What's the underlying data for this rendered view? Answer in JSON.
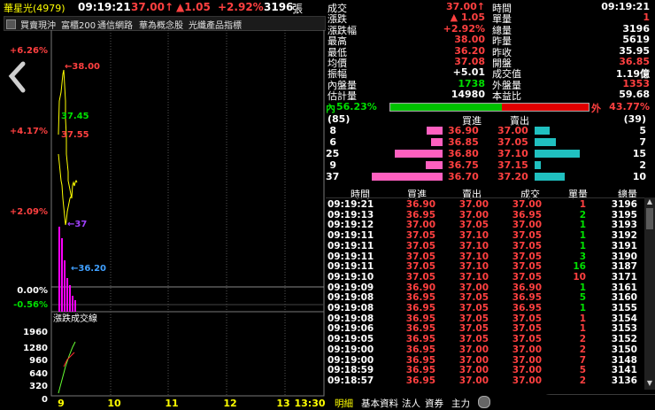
{
  "title": {
    "symbol": "華星光(4979)",
    "time": "09:19:21",
    "price": "37.00↑",
    "change": "▲1.05",
    "pct": "+2.92%",
    "volume": "3196",
    "unit": "張"
  },
  "tags": [
    "買賣現沖",
    "富櫃200",
    "通信網路",
    "華為概念股",
    "光纖產品指標"
  ],
  "chart": {
    "y_labels": [
      "+6.26%",
      "+4.17%",
      "+2.09%",
      "0.00%",
      "-0.56%"
    ],
    "x_labels": [
      "9",
      "10",
      "11",
      "12",
      "13",
      "13:30"
    ],
    "annotations": [
      "←38.00",
      "37.45",
      "37.55",
      "←37",
      "←36.20"
    ],
    "sub_title": "漲跌成交線",
    "vol_labels": [
      "1960",
      "1280",
      "960",
      "640",
      "320",
      "0"
    ],
    "nav_left_icon": "chevron-left",
    "colors": {
      "price_line": "#ffff00",
      "volume_bar": "#ff00ff",
      "vol_line_up": "#66ff33",
      "vol_line_dn": "#ff3030"
    }
  },
  "quote": {
    "left": [
      {
        "label": "成交",
        "value": "37.00↑",
        "color": "red"
      },
      {
        "label": "漲跌",
        "value": "▲  1.05",
        "color": "red"
      },
      {
        "label": "漲跌幅",
        "value": "+2.92%",
        "color": "red"
      },
      {
        "label": "最高",
        "value": "38.00",
        "color": "red"
      },
      {
        "label": "最低",
        "value": "36.20",
        "color": "red"
      },
      {
        "label": "均價",
        "value": "37.08",
        "color": "red"
      },
      {
        "label": "振幅",
        "value": "+5.01",
        "color": "wht"
      },
      {
        "label": "內盤量",
        "value": "1738",
        "color": "grn"
      },
      {
        "label": "估計量",
        "value": "14980",
        "color": "wht"
      }
    ],
    "right": [
      {
        "label": "時間",
        "value": "09:19:21",
        "color": "wht"
      },
      {
        "label": "單量",
        "value": "1",
        "color": "red"
      },
      {
        "label": "總量",
        "value": "3196",
        "color": "wht"
      },
      {
        "label": "昨量",
        "value": "5619",
        "color": "wht"
      },
      {
        "label": "昨收",
        "value": "35.95",
        "color": "wht"
      },
      {
        "label": "開盤",
        "value": "36.85",
        "color": "red"
      },
      {
        "label": "成交值",
        "value": "1.19億",
        "color": "wht"
      },
      {
        "label": "外盤量",
        "value": "1353",
        "color": "red"
      },
      {
        "label": "本益比",
        "value": "59.68",
        "color": "wht"
      }
    ]
  },
  "ratio": {
    "inner_label": "內",
    "inner_pct": "56.23%",
    "outer_label": "外",
    "outer_pct": "43.77%",
    "inner_fraction": 0.5623
  },
  "depth": {
    "bid_total": "(85)",
    "ask_total": "(39)",
    "bid_header": "買進",
    "ask_header": "賣出",
    "rows": [
      {
        "bid_qty": "8",
        "bid": "36.90",
        "ask": "37.00",
        "ask_qty": "5",
        "bid_frac": 0.22,
        "ask_frac": 0.5
      },
      {
        "bid_qty": "6",
        "bid": "36.85",
        "ask": "37.05",
        "ask_qty": "7",
        "bid_frac": 0.16,
        "ask_frac": 0.7
      },
      {
        "bid_qty": "25",
        "bid": "36.80",
        "ask": "37.10",
        "ask_qty": "15",
        "bid_frac": 0.68,
        "ask_frac": 1.5
      },
      {
        "bid_qty": "9",
        "bid": "36.75",
        "ask": "37.15",
        "ask_qty": "2",
        "bid_frac": 0.24,
        "ask_frac": 0.2
      },
      {
        "bid_qty": "37",
        "bid": "36.70",
        "ask": "37.20",
        "ask_qty": "10",
        "bid_frac": 1.0,
        "ask_frac": 1.0
      }
    ]
  },
  "ticks": {
    "headers": [
      "時間",
      "買進",
      "賣出",
      "成交",
      "單量",
      "總量"
    ],
    "rows": [
      [
        "09:19:21",
        "36.90",
        "37.00",
        "37.00",
        "1",
        "3196"
      ],
      [
        "09:19:13",
        "36.95",
        "37.00",
        "36.95",
        "2",
        "3195"
      ],
      [
        "09:19:12",
        "37.00",
        "37.05",
        "37.00",
        "1",
        "3193"
      ],
      [
        "09:19:11",
        "37.05",
        "37.10",
        "37.05",
        "1",
        "3192"
      ],
      [
        "09:19:11",
        "37.05",
        "37.10",
        "37.05",
        "1",
        "3191"
      ],
      [
        "09:19:11",
        "37.05",
        "37.10",
        "37.05",
        "3",
        "3190"
      ],
      [
        "09:19:11",
        "37.05",
        "37.10",
        "37.05",
        "16",
        "3187"
      ],
      [
        "09:19:10",
        "37.05",
        "37.10",
        "37.05",
        "10",
        "3171"
      ],
      [
        "09:19:09",
        "36.90",
        "37.00",
        "36.90",
        "1",
        "3161"
      ],
      [
        "09:19:08",
        "36.95",
        "37.05",
        "36.95",
        "5",
        "3160"
      ],
      [
        "09:19:08",
        "36.95",
        "37.05",
        "36.95",
        "1",
        "3155"
      ],
      [
        "09:19:08",
        "36.95",
        "37.05",
        "37.05",
        "1",
        "3154"
      ],
      [
        "09:19:06",
        "36.95",
        "37.05",
        "37.05",
        "1",
        "3153"
      ],
      [
        "09:19:05",
        "36.95",
        "37.05",
        "37.05",
        "2",
        "3152"
      ],
      [
        "09:19:00",
        "36.95",
        "37.00",
        "37.00",
        "2",
        "3150"
      ],
      [
        "09:19:00",
        "36.95",
        "37.00",
        "37.00",
        "7",
        "3148"
      ],
      [
        "09:18:59",
        "36.95",
        "37.00",
        "37.00",
        "5",
        "3141"
      ],
      [
        "09:18:57",
        "36.95",
        "37.00",
        "37.00",
        "2",
        "3136"
      ]
    ],
    "row_colors": [
      [
        "w",
        "r",
        "r",
        "r",
        "r",
        "w"
      ],
      [
        "w",
        "r",
        "r",
        "r",
        "g",
        "w"
      ],
      [
        "w",
        "r",
        "r",
        "r",
        "g",
        "w"
      ],
      [
        "w",
        "r",
        "r",
        "r",
        "g",
        "w"
      ],
      [
        "w",
        "r",
        "r",
        "r",
        "g",
        "w"
      ],
      [
        "w",
        "r",
        "r",
        "r",
        "g",
        "w"
      ],
      [
        "w",
        "r",
        "r",
        "r",
        "g",
        "w"
      ],
      [
        "w",
        "r",
        "r",
        "r",
        "r",
        "w"
      ],
      [
        "w",
        "r",
        "r",
        "r",
        "g",
        "w"
      ],
      [
        "w",
        "r",
        "r",
        "r",
        "g",
        "w"
      ],
      [
        "w",
        "r",
        "r",
        "r",
        "g",
        "w"
      ],
      [
        "w",
        "r",
        "r",
        "r",
        "r",
        "w"
      ],
      [
        "w",
        "r",
        "r",
        "r",
        "r",
        "w"
      ],
      [
        "w",
        "r",
        "r",
        "r",
        "r",
        "w"
      ],
      [
        "w",
        "r",
        "r",
        "r",
        "r",
        "w"
      ],
      [
        "w",
        "r",
        "r",
        "r",
        "r",
        "w"
      ],
      [
        "w",
        "r",
        "r",
        "r",
        "r",
        "w"
      ],
      [
        "w",
        "r",
        "r",
        "r",
        "r",
        "w"
      ]
    ]
  },
  "tabs": [
    "明細",
    "基本資料",
    "法人",
    "資券",
    "主力"
  ]
}
